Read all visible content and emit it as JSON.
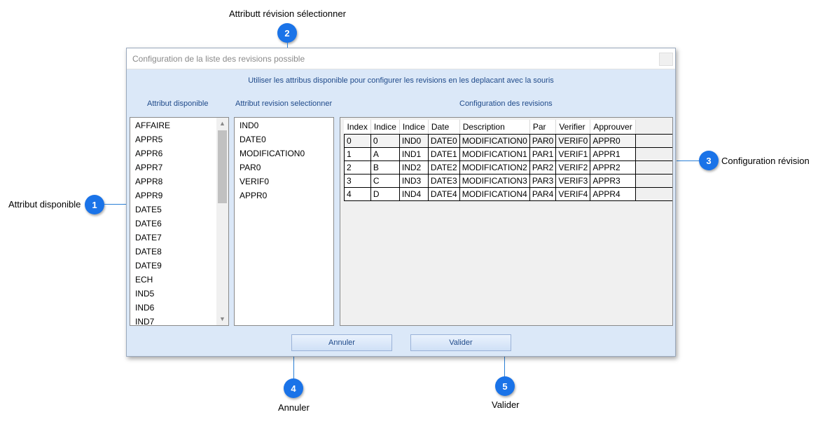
{
  "annotations": {
    "c1": {
      "number": "1",
      "label": "Attribut disponible"
    },
    "c2": {
      "number": "2",
      "label": "Attributt révision sélectionner"
    },
    "c3": {
      "number": "3",
      "label": "Configuration révision"
    },
    "c4": {
      "number": "4",
      "label": "Annuler"
    },
    "c5": {
      "number": "5",
      "label": "Valider"
    }
  },
  "window": {
    "title": "Configuration de la liste des revisions possible",
    "hint": "Utiliser les attribus disponible pour configurer les revisions en les deplacant avec la souris"
  },
  "labels": {
    "available": "Attribut disponible",
    "selected": "Attribut revision selectionner",
    "config": "Configuration des revisions"
  },
  "available_items": [
    "AFFAIRE",
    "APPR5",
    "APPR6",
    "APPR7",
    "APPR8",
    "APPR9",
    "DATE5",
    "DATE6",
    "DATE7",
    "DATE8",
    "DATE9",
    "ECH",
    "IND5",
    "IND6",
    "IND7"
  ],
  "selected_items": [
    "IND0",
    "DATE0",
    "MODIFICATION0",
    "PAR0",
    "VERIF0",
    "APPR0"
  ],
  "grid": {
    "columns": [
      "Index",
      "Indice",
      "Indice",
      "Date",
      "Description",
      "Par",
      "Verifier",
      "Approuver"
    ],
    "rows": [
      [
        "0",
        "0",
        "IND0",
        "DATE0",
        "MODIFICATION0",
        "PAR0",
        "VERIF0",
        "APPR0"
      ],
      [
        "1",
        "A",
        "IND1",
        "DATE1",
        "MODIFICATION1",
        "PAR1",
        "VERIF1",
        "APPR1"
      ],
      [
        "2",
        "B",
        "IND2",
        "DATE2",
        "MODIFICATION2",
        "PAR2",
        "VERIF2",
        "APPR2"
      ],
      [
        "3",
        "C",
        "IND3",
        "DATE3",
        "MODIFICATION3",
        "PAR3",
        "VERIF3",
        "APPR3"
      ],
      [
        "4",
        "D",
        "IND4",
        "DATE4",
        "MODIFICATION4",
        "PAR4",
        "VERIF4",
        "APPR4"
      ]
    ]
  },
  "buttons": {
    "cancel": "Annuler",
    "validate": "Valider"
  },
  "colors": {
    "badge": "#1a73e8",
    "dialog_bg": "#dbe8f8",
    "accent_text": "#1f4a8a"
  }
}
